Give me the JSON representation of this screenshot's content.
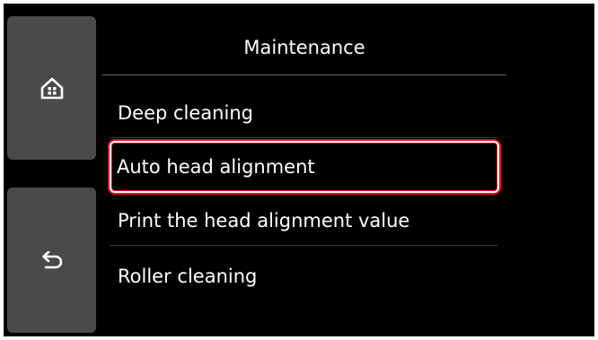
{
  "screen": {
    "title": "Maintenance"
  },
  "side_buttons": {
    "home_icon": "home-icon",
    "back_icon": "back-arrow-icon"
  },
  "menu": {
    "items": [
      {
        "label": "Deep cleaning"
      },
      {
        "label": "Auto head alignment",
        "highlighted": true
      },
      {
        "label": "Print the head alignment value"
      },
      {
        "label": "Roller cleaning"
      }
    ]
  },
  "colors": {
    "background": "#000000",
    "side_button": "#4a4a4a",
    "highlight_outline": "#e01423",
    "text": "#ffffff"
  }
}
